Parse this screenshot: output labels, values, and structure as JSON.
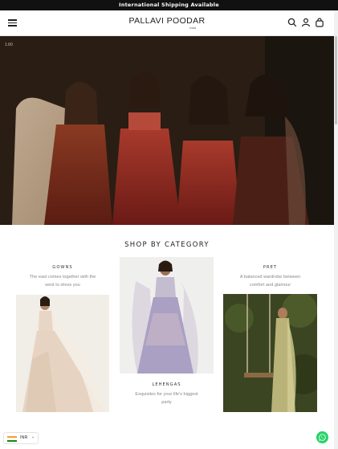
{
  "announcement": "International Shipping Available",
  "header": {
    "logo_main": "PALLAVI POODAR",
    "logo_sub": "India",
    "icons": [
      "menu-icon",
      "search-icon",
      "account-icon",
      "bag-icon"
    ]
  },
  "hero": {
    "badge": "1.60"
  },
  "section_title": "SHOP BY CATEGORY",
  "categories": [
    {
      "title": "GOWNS",
      "description_line1": "The east comes together with the",
      "description_line2": "west to dress you"
    },
    {
      "title": "LEHENGAS",
      "description_line1": "Exquisites for your life's biggest",
      "description_line2": "party"
    },
    {
      "title": "PRET",
      "description_line1": "A balanced wardrobe between",
      "description_line2": "comfort and glamour"
    }
  ],
  "currency": {
    "label": "INR",
    "chevron": "⌄"
  },
  "colors": {
    "announcement_bg": "#111111",
    "whatsapp": "#25D366",
    "text": "#222222"
  }
}
